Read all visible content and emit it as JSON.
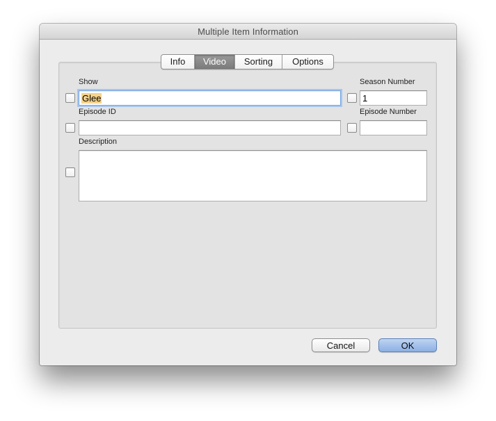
{
  "window": {
    "title": "Multiple Item Information"
  },
  "tabs": [
    {
      "label": "Info",
      "active": false
    },
    {
      "label": "Video",
      "active": true
    },
    {
      "label": "Sorting",
      "active": false
    },
    {
      "label": "Options",
      "active": false
    }
  ],
  "form": {
    "show": {
      "label": "Show",
      "value": "Glee",
      "checked": false
    },
    "season_number": {
      "label": "Season Number",
      "value": "1",
      "checked": false
    },
    "episode_id": {
      "label": "Episode ID",
      "value": "",
      "checked": false
    },
    "episode_number": {
      "label": "Episode Number",
      "value": "",
      "checked": false
    },
    "description": {
      "label": "Description",
      "value": "",
      "checked": false
    }
  },
  "buttons": {
    "cancel_label": "Cancel",
    "ok_label": "OK"
  },
  "colors": {
    "focus_ring": "#a6c6ef",
    "selection_highlight": "#f6d28a",
    "default_button": "#8bb0e4"
  }
}
